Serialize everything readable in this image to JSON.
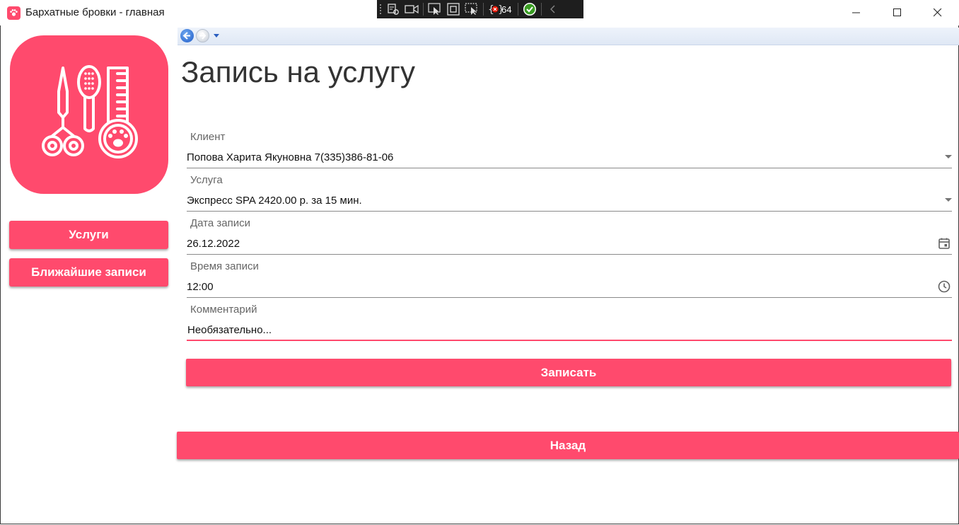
{
  "window": {
    "title": "Бархатные бровки - главная",
    "app_icon": "paw-app-icon",
    "controls": [
      "minimize-icon",
      "maximize-icon",
      "close-icon"
    ]
  },
  "debug_toolbar": {
    "icons": [
      "live-visual-tree-icon",
      "record-icon",
      "select-element-icon",
      "display-layout-adorners-icon",
      "track-focused-element-icon",
      "binding-failures-icon",
      "hot-reload-check-icon",
      "collapse-chevron-icon"
    ],
    "binding_failures_count": "64"
  },
  "sidebar": {
    "logo_icon": "grooming-tools-icon",
    "buttons": [
      {
        "label": "Услуги"
      },
      {
        "label": "Ближайшие записи"
      }
    ]
  },
  "nav": {
    "icons": [
      "back-arrow-icon",
      "forward-arrow-icon",
      "history-dropdown-icon"
    ]
  },
  "page": {
    "title": "Запись на услугу",
    "fields": {
      "client": {
        "label": "Клиент",
        "value": "Попова Харита Якуновна 7(335)386-81-06"
      },
      "service": {
        "label": "Услуга",
        "value": "Экспресс SPA 2420.00 р. за 15 мин."
      },
      "date": {
        "label": "Дата записи",
        "value": "26.12.2022"
      },
      "time": {
        "label": "Время записи",
        "value": "12:00"
      },
      "comment": {
        "label": "Комментарий",
        "placeholder": "Необязательно..."
      }
    },
    "submit_label": "Записать",
    "back_label": "Назад"
  },
  "colors": {
    "accent": "#ff4a6d",
    "debug_bar": "#1e1e1e",
    "text": "#212121"
  }
}
